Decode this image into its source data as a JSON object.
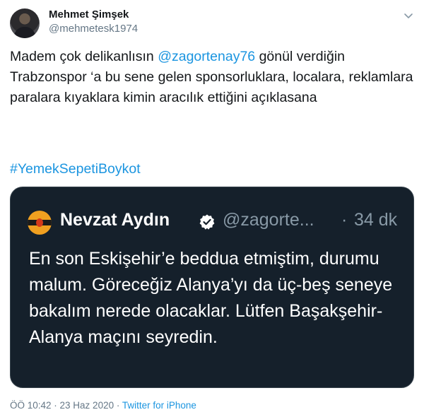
{
  "tweet": {
    "author": {
      "name": "Mehmet Şimşek",
      "handle": "@mehmetesk1974"
    },
    "text": {
      "part1": "Madem çok delikanlısın ",
      "mention": "@zagortenay76",
      "part2": " gönül verdiğin Trabzonspor ‘a bu sene gelen sponsorluklara, localara, reklamlara paralara kıyaklara kimin aracılık ettiğini açıklasana"
    },
    "hashtag": "#YemekSepetiBoykot",
    "quoted": {
      "name": "Nevzat Aydın",
      "handle": "@zagorte...",
      "separator": "·",
      "time": "34 dk",
      "text": "En son Eskişehir’e beddua etmiştim, durumu malum. Göreceğiz Alanya’yı da üç-beş seneye bakalım nerede olacaklar. Lütfen Başakşehir-Alanya maçını seyredin."
    },
    "meta": {
      "timestamp": "ÖÖ 10:42 · 23 Haz 2020 · ",
      "source": "Twitter for iPhone"
    }
  },
  "icons": {
    "caret": "chevron-down-icon",
    "verified": "verified-badge-icon"
  },
  "colors": {
    "link": "#1b95e0",
    "quote_background": "#15202b",
    "secondary_text": "#657786"
  }
}
